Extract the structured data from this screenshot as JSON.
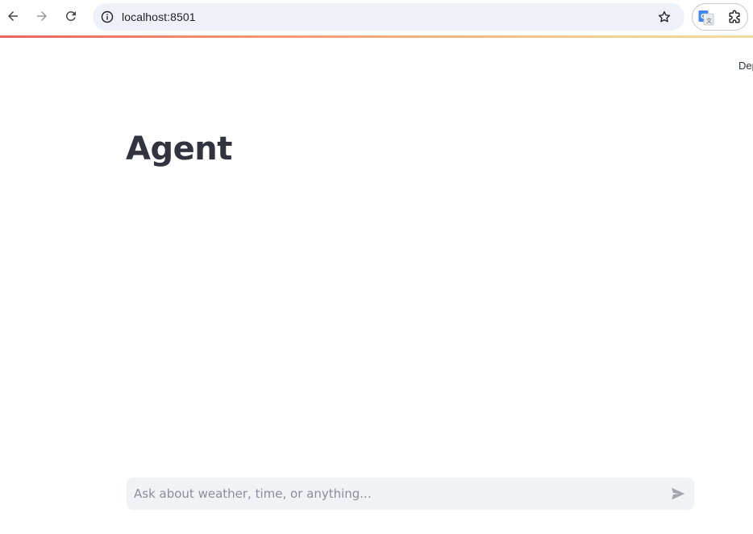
{
  "browser": {
    "url": "localhost:8501",
    "icons": {
      "back": "arrow-left-icon",
      "forward": "arrow-right-icon",
      "reload": "reload-icon",
      "site_info": "info-icon",
      "bookmark": "star-icon",
      "translate": "google-translate-icon",
      "extensions": "puzzle-icon"
    },
    "loading_bar_colors": [
      "#e8655f",
      "#f4b07a",
      "#f1dc9a"
    ]
  },
  "header": {
    "deploy_label_partial": "Dep"
  },
  "main": {
    "title": "Agent"
  },
  "chat": {
    "placeholder": "Ask about weather, time, or anything...",
    "value": "",
    "send_icon": "send-icon"
  },
  "colors": {
    "text": "#31333f",
    "input_bg": "#f0f2f6",
    "omnibox_bg": "#eef2f8"
  }
}
